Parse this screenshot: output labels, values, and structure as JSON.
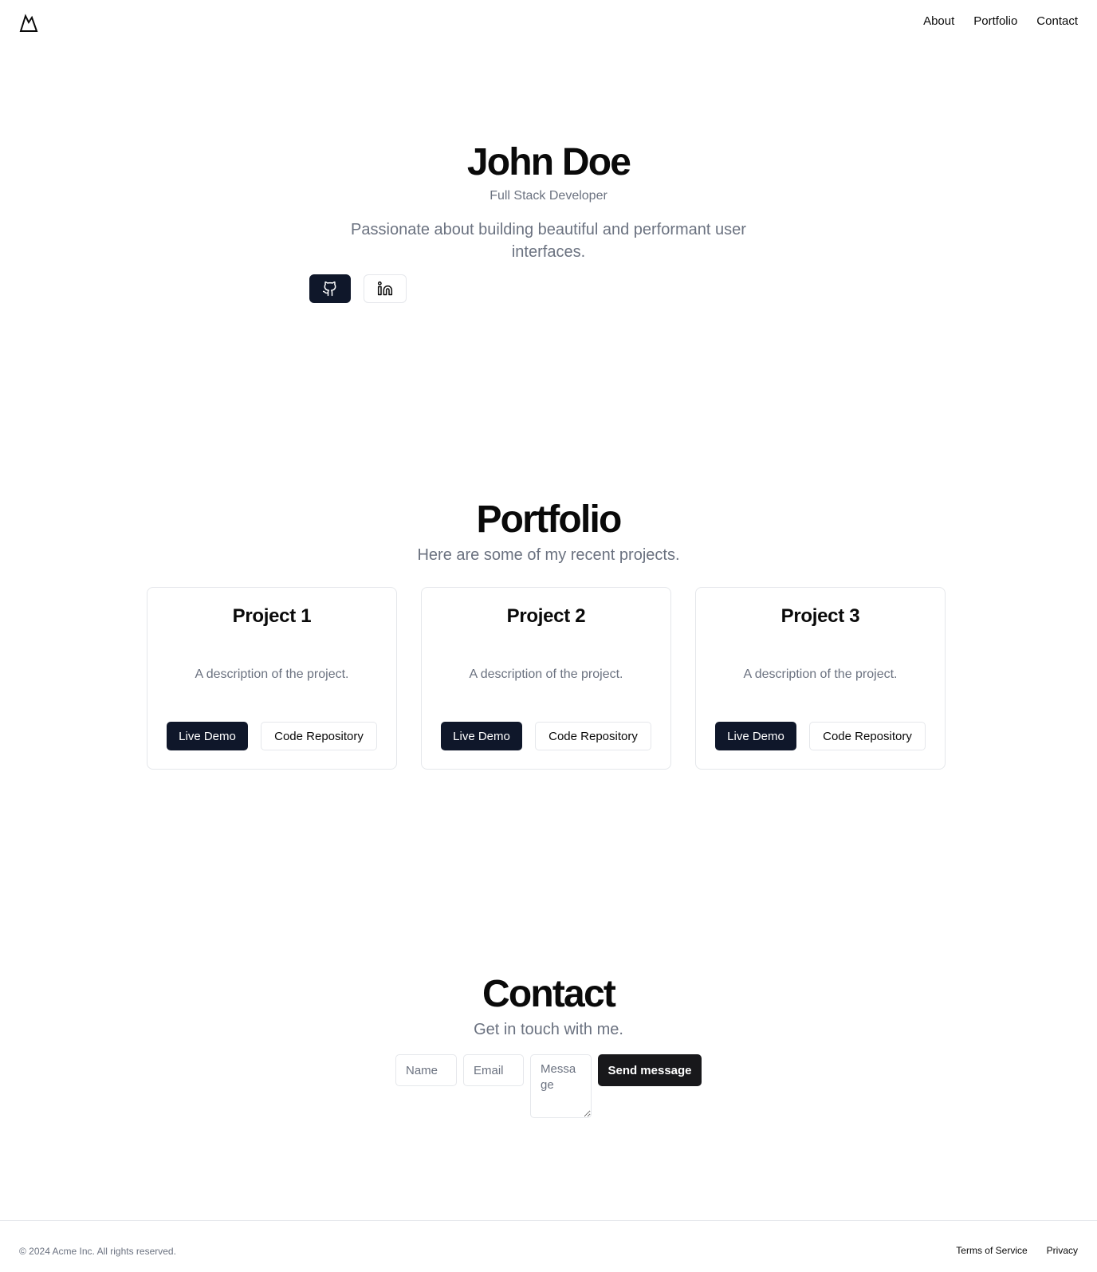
{
  "header": {
    "logo_icon": "mountain-icon",
    "nav": [
      {
        "label": "About"
      },
      {
        "label": "Portfolio"
      },
      {
        "label": "Contact"
      }
    ]
  },
  "hero": {
    "name": "John Doe",
    "role": "Full Stack Developer",
    "bio": "Passionate about building beautiful and performant user interfaces.",
    "social": [
      {
        "icon": "github-icon"
      },
      {
        "icon": "linkedin-icon"
      }
    ]
  },
  "portfolio": {
    "title": "Portfolio",
    "subtitle": "Here are some of my recent projects.",
    "projects": [
      {
        "title": "Project 1",
        "description": "A description of the project.",
        "demo_label": "Live Demo",
        "repo_label": "Code Repository"
      },
      {
        "title": "Project 2",
        "description": "A description of the project.",
        "demo_label": "Live Demo",
        "repo_label": "Code Repository"
      },
      {
        "title": "Project 3",
        "description": "A description of the project.",
        "demo_label": "Live Demo",
        "repo_label": "Code Repository"
      }
    ]
  },
  "contact": {
    "title": "Contact",
    "subtitle": "Get in touch with me.",
    "name_placeholder": "Name",
    "email_placeholder": "Email",
    "message_placeholder": "Message",
    "send_label": "Send message"
  },
  "footer": {
    "copyright": "© 2024 Acme Inc. All rights reserved.",
    "links": [
      {
        "label": "Terms of Service"
      },
      {
        "label": "Privacy"
      }
    ]
  },
  "colors": {
    "primary_button": "#0f172a",
    "send_button": "#18181b",
    "muted_text": "#6b7280",
    "border": "#e5e7eb"
  }
}
